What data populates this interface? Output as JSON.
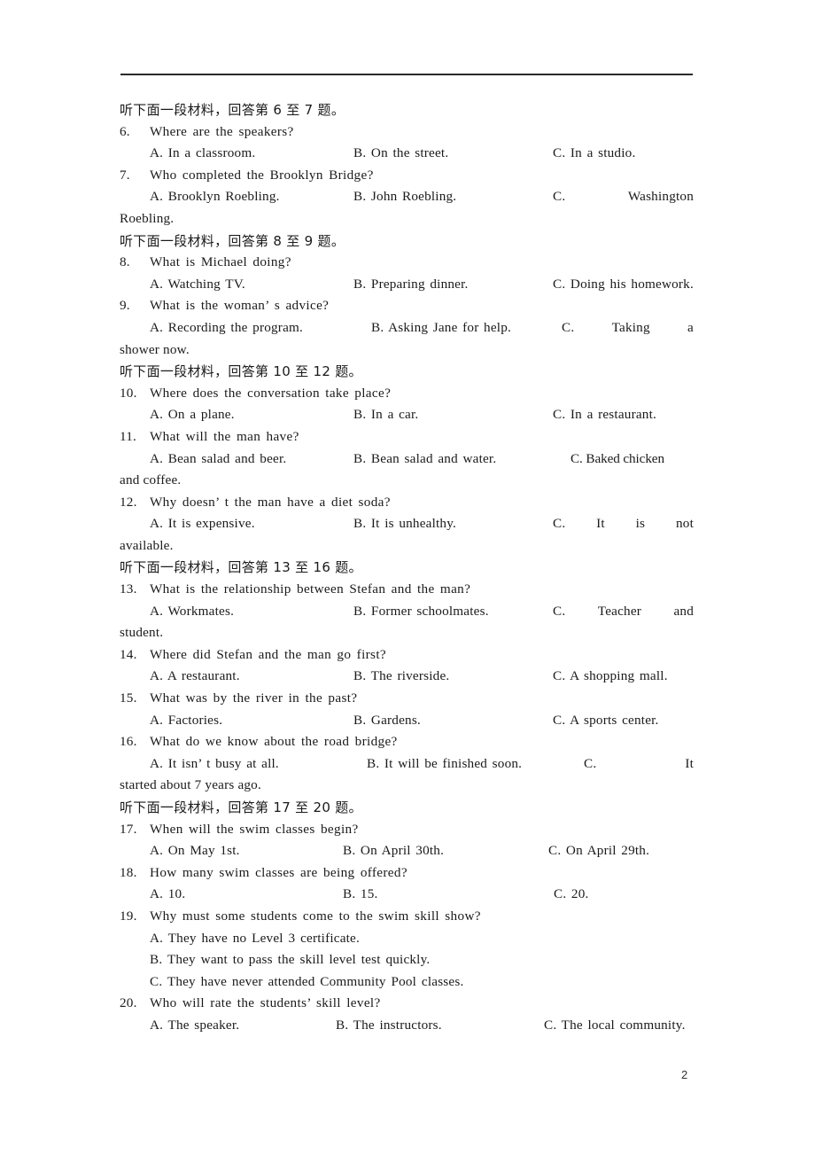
{
  "document": {
    "page_number": "2",
    "header_rule": true
  },
  "sections": [
    {
      "heading": "听下面一段材料，回答第 6 至 7 题。",
      "questions": [
        {
          "number": "6.",
          "stem": "Where are the speakers?",
          "layout": "row",
          "options": [
            "A. In a classroom.",
            "B. On the street.",
            "C. In a studio."
          ]
        },
        {
          "number": "7.",
          "stem": "Who completed the Brooklyn Bridge?",
          "layout": "row-justified",
          "options": [
            "A. Brooklyn Roebling.",
            "B. John Roebling.",
            "C.",
            "Washington"
          ],
          "continuation": "Roebling."
        }
      ]
    },
    {
      "heading": "听下面一段材料，回答第 8 至 9 题。",
      "questions": [
        {
          "number": "8.",
          "stem": "What is Michael doing?",
          "layout": "row",
          "options": [
            "A. Watching TV.",
            "B. Preparing dinner.",
            "C. Doing his homework."
          ]
        },
        {
          "number": "9.",
          "stem": "What is the woman’ s advice?",
          "layout": "row-justified",
          "options": [
            "A. Recording the program.",
            "B. Asking Jane for help.",
            "C.",
            "Taking",
            "a"
          ],
          "continuation": "shower now."
        }
      ]
    },
    {
      "heading": "听下面一段材料，回答第 10 至 12 题。",
      "questions": [
        {
          "number": "10.",
          "stem": "Where does the conversation take place?",
          "layout": "row",
          "options": [
            "A. On a plane.",
            "B. In a car.",
            "C. In a restaurant."
          ]
        },
        {
          "number": "11.",
          "stem": "What will the man have?",
          "layout": "row",
          "options": [
            "A. Bean salad and beer.",
            "B. Bean salad and water.",
            "C. Baked chicken"
          ],
          "continuation": "and coffee."
        },
        {
          "number": "12.",
          "stem": "Why doesn’ t the man have a diet soda?",
          "layout": "row-justified",
          "options": [
            "A. It is expensive.",
            "B. It is unhealthy.",
            "C.",
            "It",
            "is",
            "not"
          ],
          "continuation": "available."
        }
      ]
    },
    {
      "heading": "听下面一段材料，回答第 13 至 16 题。",
      "questions": [
        {
          "number": "13.",
          "stem": "What is the relationship between Stefan and the man?",
          "layout": "row-justified",
          "options": [
            "A. Workmates.",
            "B. Former schoolmates.",
            "C.",
            "Teacher",
            "and"
          ],
          "continuation": "student."
        },
        {
          "number": "14.",
          "stem": "Where did Stefan and the man go first?",
          "layout": "row",
          "options": [
            "A. A restaurant.",
            "B. The riverside.",
            "C. A shopping mall."
          ]
        },
        {
          "number": "15.",
          "stem": "What was by the river in the past?",
          "layout": "row",
          "options": [
            "A. Factories.",
            "B. Gardens.",
            "C. A sports center."
          ]
        },
        {
          "number": "16.",
          "stem": "What do we know about the road bridge?",
          "layout": "row-justified",
          "options": [
            "A. It isn’ t busy at all.",
            "B. It will be finished soon.",
            "C.",
            "It"
          ],
          "continuation": "started about 7 years ago."
        }
      ]
    },
    {
      "heading": "听下面一段材料，回答第 17 至 20 题。",
      "questions": [
        {
          "number": "17.",
          "stem": "When will the swim classes begin?",
          "layout": "row",
          "options": [
            "A. On May 1st.",
            "B. On April 30th.",
            "C. On April 29th."
          ]
        },
        {
          "number": "18.",
          "stem": "How many swim classes are being offered?",
          "layout": "row",
          "options": [
            "A. 10.",
            "B. 15.",
            "C. 20."
          ]
        },
        {
          "number": "19.",
          "stem": "Why must some students come to the swim skill show?",
          "layout": "stack",
          "options": [
            "A. They have no Level 3 certificate.",
            "B. They want to pass the skill level test quickly.",
            "C. They have never attended Community Pool classes."
          ]
        },
        {
          "number": "20.",
          "stem": "Who will rate the students’  skill level?",
          "layout": "row",
          "options": [
            "A. The speaker.",
            "B. The instructors.",
            "C. The local community."
          ]
        }
      ]
    }
  ]
}
